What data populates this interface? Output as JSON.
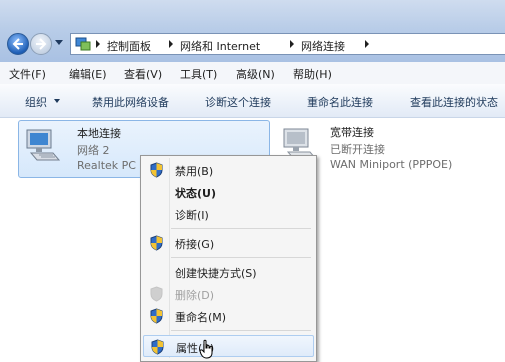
{
  "address": {
    "crumbs": [
      "控制面板",
      "网络和 Internet",
      "网络连接"
    ]
  },
  "menubar": [
    "文件(F)",
    "编辑(E)",
    "查看(V)",
    "工具(T)",
    "高级(N)",
    "帮助(H)"
  ],
  "commands": {
    "organize": "组织",
    "disable": "禁用此网络设备",
    "diagnose": "诊断这个连接",
    "rename": "重命名此连接",
    "view_status": "查看此连接的状态"
  },
  "connections": [
    {
      "name": "本地连接",
      "line1": "网络  2",
      "line2": "Realtek PC"
    },
    {
      "name": "宽带连接",
      "line1": "已断开连接",
      "line2": "WAN Miniport (PPPOE)"
    }
  ],
  "context_menu": {
    "disable": "禁用(B)",
    "status": "状态(U)",
    "diagnose": "诊断(I)",
    "bridge": "桥接(G)",
    "shortcut": "创建快捷方式(S)",
    "delete": "删除(D)",
    "rename": "重命名(M)",
    "properties": "属性(R)"
  },
  "colors": {
    "title_gradient": "#b9cde8",
    "selection": "#d6e8fb",
    "command_text": "#1e395b",
    "disabled_text": "#a0a0a0"
  }
}
